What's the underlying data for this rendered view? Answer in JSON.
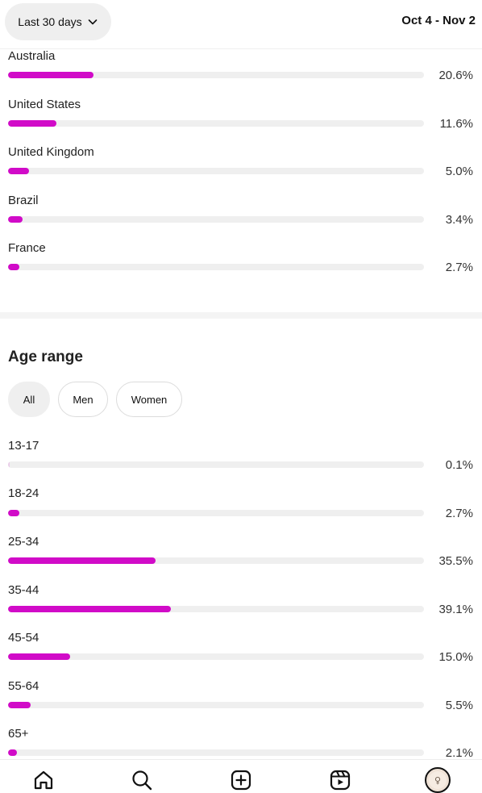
{
  "header": {
    "period_label": "Last 30 days",
    "date_range": "Oct 4 - Nov 2"
  },
  "countries": [
    {
      "label": "Australia",
      "value": 20.6,
      "pct": "20.6%"
    },
    {
      "label": "United States",
      "value": 11.6,
      "pct": "11.6%"
    },
    {
      "label": "United Kingdom",
      "value": 5.0,
      "pct": "5.0%"
    },
    {
      "label": "Brazil",
      "value": 3.4,
      "pct": "3.4%"
    },
    {
      "label": "France",
      "value": 2.7,
      "pct": "2.7%"
    }
  ],
  "age_section": {
    "title": "Age range",
    "filters": [
      {
        "label": "All",
        "selected": true
      },
      {
        "label": "Men",
        "selected": false
      },
      {
        "label": "Women",
        "selected": false
      }
    ],
    "rows": [
      {
        "label": "13-17",
        "value": 0.1,
        "pct": "0.1%"
      },
      {
        "label": "18-24",
        "value": 2.7,
        "pct": "2.7%"
      },
      {
        "label": "25-34",
        "value": 35.5,
        "pct": "35.5%"
      },
      {
        "label": "35-44",
        "value": 39.1,
        "pct": "39.1%"
      },
      {
        "label": "45-54",
        "value": 15.0,
        "pct": "15.0%"
      },
      {
        "label": "55-64",
        "value": 5.5,
        "pct": "5.5%"
      },
      {
        "label": "65+",
        "value": 2.1,
        "pct": "2.1%"
      }
    ]
  },
  "bar_color": "#d10bc8",
  "track_color": "#efefef",
  "nav": {
    "items": [
      "home-icon",
      "search-icon",
      "create-icon",
      "reels-icon",
      "profile-avatar"
    ]
  }
}
